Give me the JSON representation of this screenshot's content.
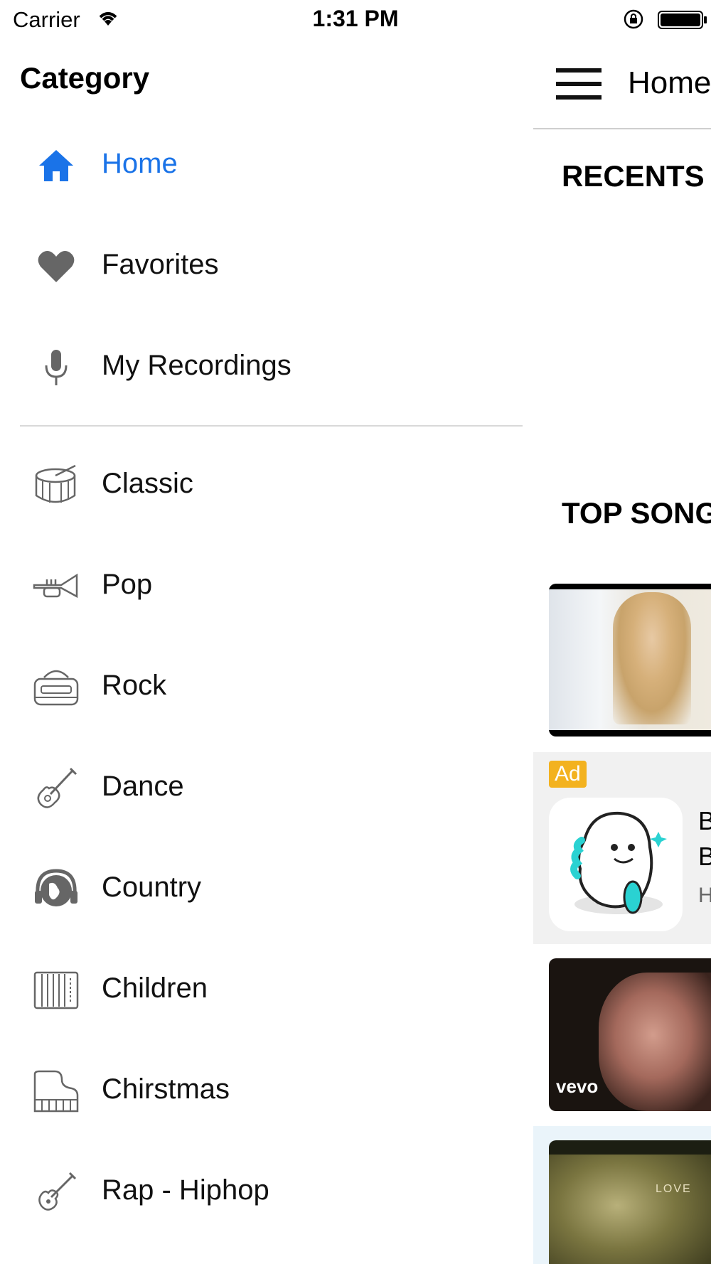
{
  "status_bar": {
    "carrier": "Carrier",
    "time": "1:31 PM"
  },
  "drawer": {
    "title": "Category",
    "items": [
      {
        "label": "Home",
        "icon": "home-icon",
        "active": true
      },
      {
        "label": "Favorites",
        "icon": "heart-icon"
      },
      {
        "label": "My Recordings",
        "icon": "microphone-icon"
      },
      {
        "label": "Classic",
        "icon": "drum-icon"
      },
      {
        "label": "Pop",
        "icon": "trumpet-icon"
      },
      {
        "label": "Rock",
        "icon": "boombox-icon"
      },
      {
        "label": "Dance",
        "icon": "guitar-icon"
      },
      {
        "label": "Country",
        "icon": "globe-headphones-icon"
      },
      {
        "label": "Children",
        "icon": "accordion-icon"
      },
      {
        "label": "Chirstmas",
        "icon": "piano-icon"
      },
      {
        "label": "Rap - Hiphop",
        "icon": "electric-guitar-icon"
      }
    ]
  },
  "main": {
    "header_title": "Home",
    "recents_title": "RECENTS",
    "top_songs_title": "TOP SONG",
    "ad": {
      "badge": "Ad",
      "line1": "B",
      "line2": "B",
      "line3": "H"
    },
    "video2_watermark": "vevo",
    "video3_text": "LOVE"
  },
  "colors": {
    "accent": "#1a73e8",
    "icon_gray": "#666666",
    "ad_badge": "#f3b21f"
  }
}
